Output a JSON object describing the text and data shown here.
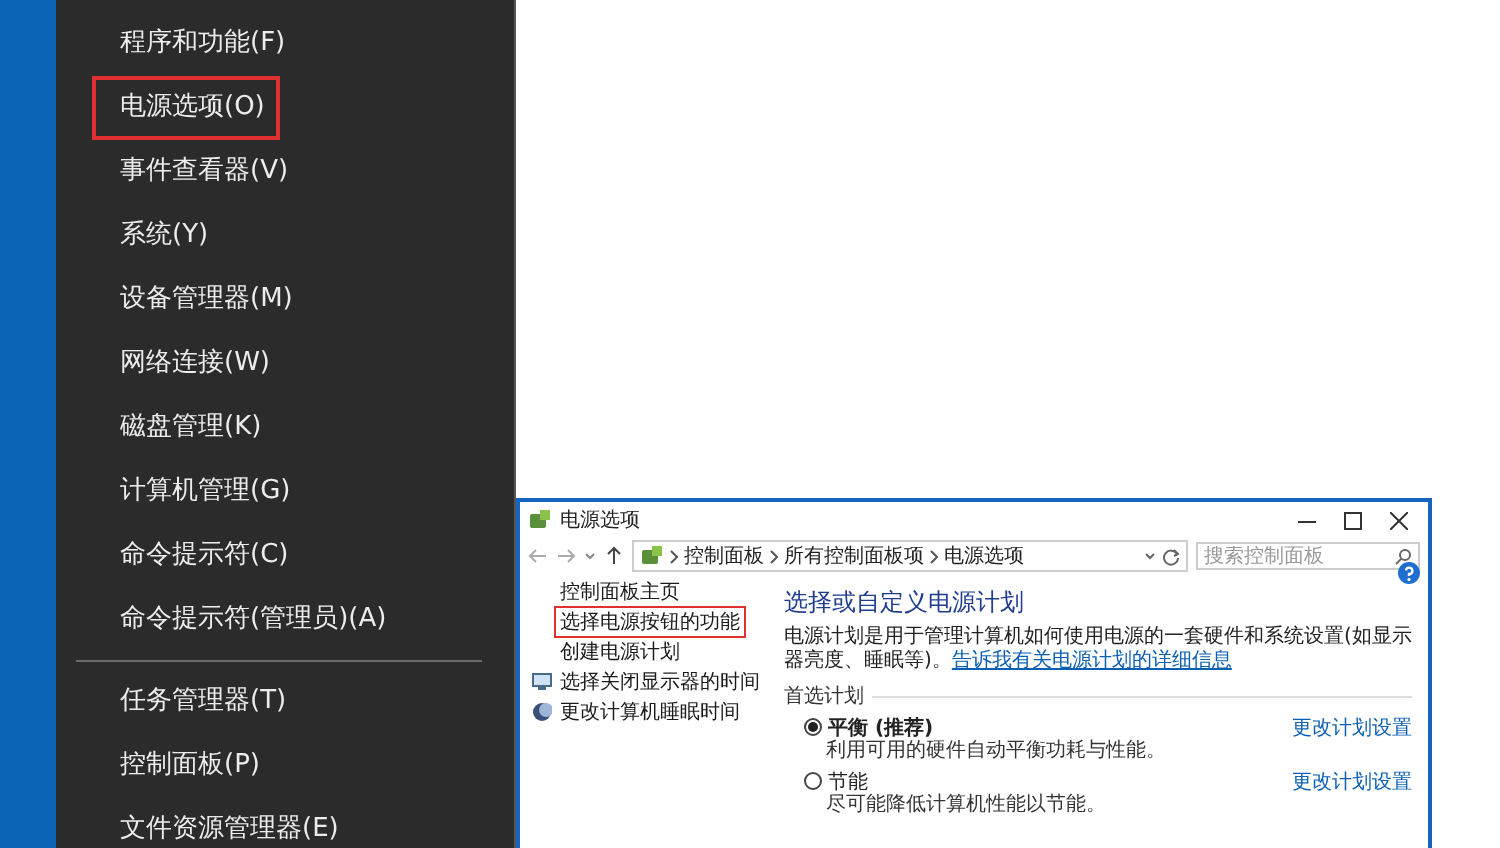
{
  "context_menu": {
    "items": [
      {
        "label": "程序和功能(F)",
        "outlined": false,
        "kind": "item"
      },
      {
        "label": "电源选项(O)",
        "outlined": true,
        "kind": "item"
      },
      {
        "label": "事件查看器(V)",
        "outlined": false,
        "kind": "item"
      },
      {
        "label": "系统(Y)",
        "outlined": false,
        "kind": "item"
      },
      {
        "label": "设备管理器(M)",
        "outlined": false,
        "kind": "item"
      },
      {
        "label": "网络连接(W)",
        "outlined": false,
        "kind": "item"
      },
      {
        "label": "磁盘管理(K)",
        "outlined": false,
        "kind": "item"
      },
      {
        "label": "计算机管理(G)",
        "outlined": false,
        "kind": "item"
      },
      {
        "label": "命令提示符(C)",
        "outlined": false,
        "kind": "item"
      },
      {
        "label": "命令提示符(管理员)(A)",
        "outlined": false,
        "kind": "item"
      },
      {
        "kind": "separator"
      },
      {
        "label": "任务管理器(T)",
        "outlined": false,
        "kind": "item"
      },
      {
        "label": "控制面板(P)",
        "outlined": false,
        "kind": "item"
      },
      {
        "label": "文件资源管理器(E)",
        "outlined": false,
        "kind": "item"
      }
    ]
  },
  "window": {
    "title": "电源选项",
    "breadcrumb": [
      "控制面板",
      "所有控制面板项",
      "电源选项"
    ],
    "search": {
      "placeholder": "搜索控制面板"
    },
    "sidebar": {
      "items": [
        {
          "label": "控制面板主页",
          "outlined": false,
          "kind": "link"
        },
        {
          "label": "选择电源按钮的功能",
          "outlined": true,
          "kind": "link"
        },
        {
          "label": "创建电源计划",
          "outlined": false,
          "kind": "link"
        },
        {
          "label": "选择关闭显示器的时间",
          "outlined": false,
          "kind": "display"
        },
        {
          "label": "更改计算机睡眠时间",
          "outlined": false,
          "kind": "sleep"
        }
      ]
    },
    "heading": "选择或自定义电源计划",
    "description": "电源计划是用于管理计算机如何使用电源的一套硬件和系统设置(如显示器亮度、睡眠等)。",
    "description_link": "告诉我有关电源计划的详细信息",
    "section_label": "首选计划",
    "plans": [
      {
        "name": "平衡 (推荐)",
        "selected": true,
        "description": "利用可用的硬件自动平衡功耗与性能。",
        "link": "更改计划设置"
      },
      {
        "name": "节能",
        "selected": false,
        "description": "尽可能降低计算机性能以节能。",
        "link": "更改计划设置"
      }
    ]
  }
}
